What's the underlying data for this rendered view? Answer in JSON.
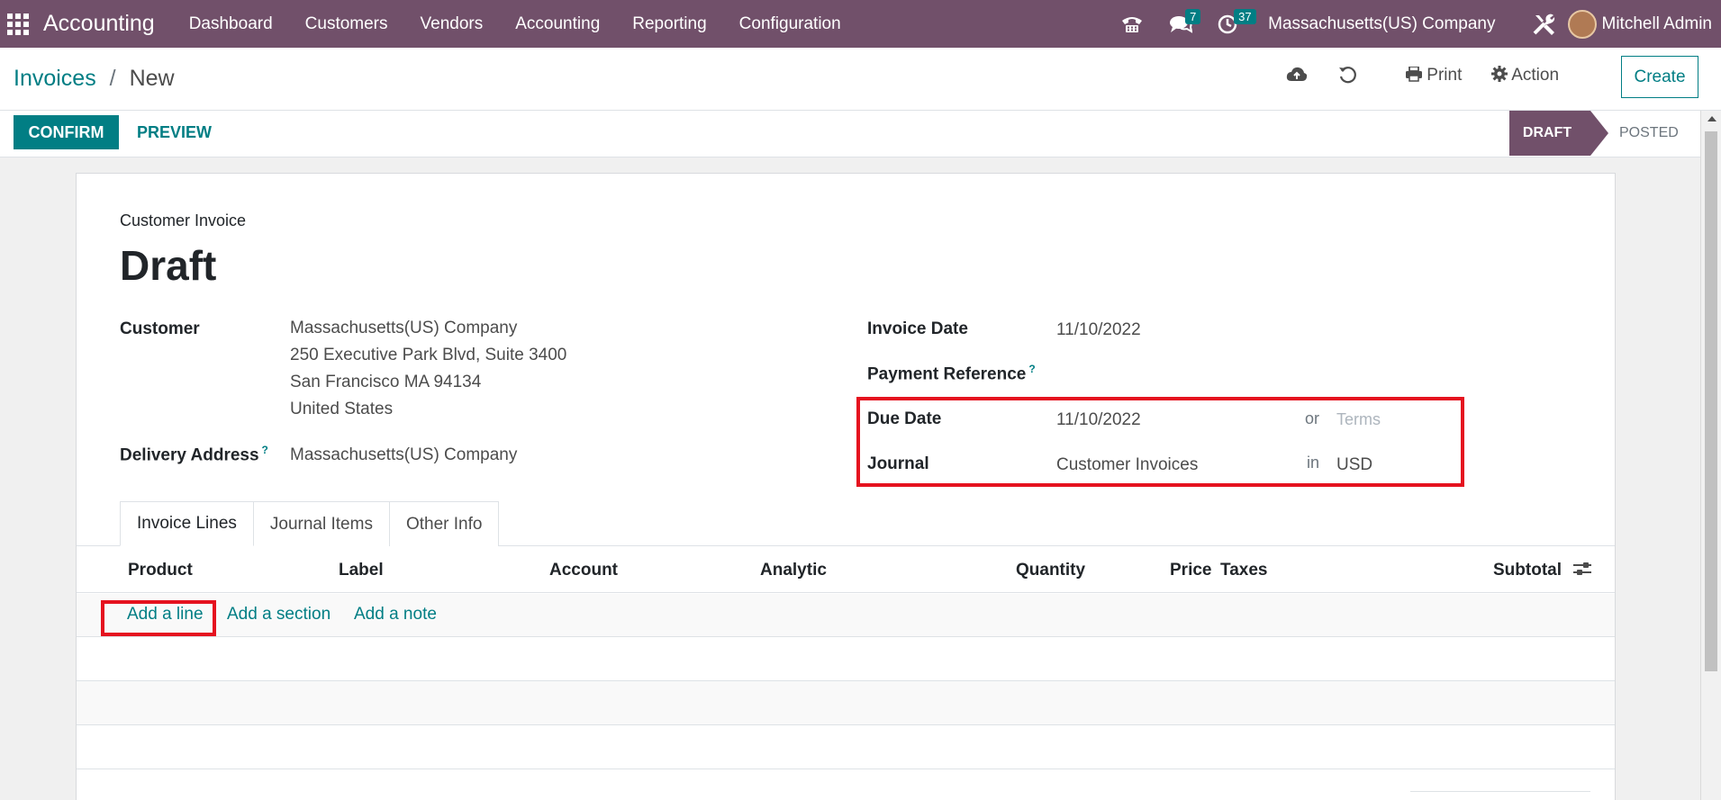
{
  "navbar": {
    "brand": "Accounting",
    "menu": [
      "Dashboard",
      "Customers",
      "Vendors",
      "Accounting",
      "Reporting",
      "Configuration"
    ],
    "messages_count": "7",
    "activities_count": "37",
    "company": "Massachusetts(US) Company",
    "user": "Mitchell Admin"
  },
  "breadcrumb": {
    "parent": "Invoices",
    "separator": "/",
    "current": "New"
  },
  "toolbar": {
    "print_label": "Print",
    "action_label": "Action",
    "create_label": "Create"
  },
  "statusbar": {
    "confirm_label": "CONFIRM",
    "preview_label": "PREVIEW",
    "stages": [
      "DRAFT",
      "POSTED"
    ]
  },
  "invoice": {
    "type": "Customer Invoice",
    "title": "Draft",
    "customer_label": "Customer",
    "customer_address": [
      "Massachusetts(US) Company",
      "250 Executive Park Blvd, Suite 3400",
      "San Francisco MA 94134",
      "United States"
    ],
    "delivery_label": "Delivery Address",
    "delivery_value": "Massachusetts(US) Company",
    "invoice_date_label": "Invoice Date",
    "invoice_date": "11/10/2022",
    "payment_ref_label": "Payment Reference",
    "due_date_label": "Due Date",
    "due_date": "11/10/2022",
    "or_text": "or",
    "terms_placeholder": "Terms",
    "journal_label": "Journal",
    "journal": "Customer Invoices",
    "in_text": "in",
    "currency": "USD",
    "tooltip_mark": "?"
  },
  "tabs": [
    "Invoice Lines",
    "Journal Items",
    "Other Info"
  ],
  "lines": {
    "columns": [
      "Product",
      "Label",
      "Account",
      "Analytic",
      "Quantity",
      "Price",
      "Taxes",
      "Subtotal"
    ],
    "add_line": "Add a line",
    "add_section": "Add a section",
    "add_note": "Add a note"
  },
  "colors": {
    "brand": "#71506a",
    "accent": "#017e84",
    "highlight": "#e5121f"
  }
}
